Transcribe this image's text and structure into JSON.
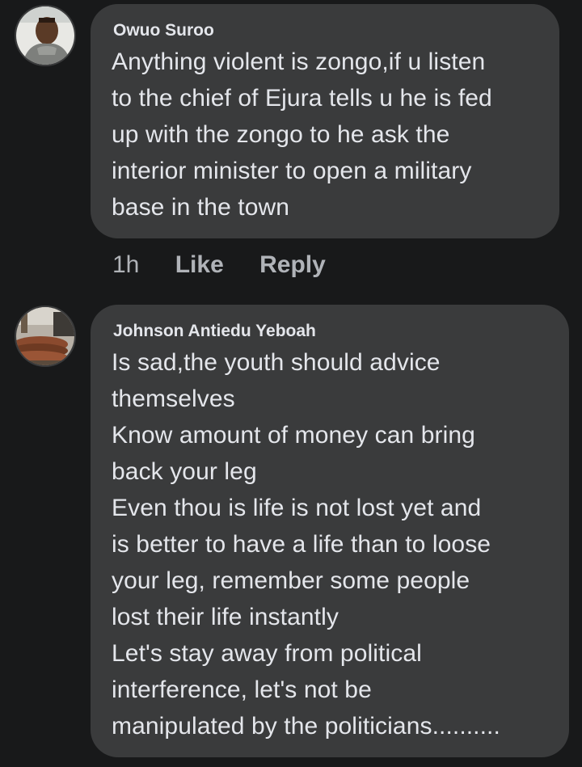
{
  "comments": [
    {
      "author": "Owuo Suroo",
      "lines": [
        "Anything violent is zongo,if u listen",
        "to the chief of Ejura tells u he is fed",
        "up with the zongo to he ask the",
        "interior minister to open a military",
        "base in the town"
      ],
      "time": "1h",
      "like_label": "Like",
      "reply_label": "Reply"
    },
    {
      "author": "Johnson Antiedu Yeboah",
      "lines": [
        "Is sad,the youth should advice",
        "themselves",
        "Know amount of money can bring",
        "back your leg",
        "Even thou is life is not lost yet and",
        "is better to have a life than to loose",
        "your leg, remember some people",
        "lost their life instantly",
        "Let's stay away from political",
        "interference, let's not be",
        "manipulated by the politicians.........."
      ]
    }
  ],
  "colors": {
    "background": "#18191a",
    "bubble": "#3a3b3c",
    "text": "#e4e6eb",
    "secondary_text": "#b0b3b8"
  }
}
